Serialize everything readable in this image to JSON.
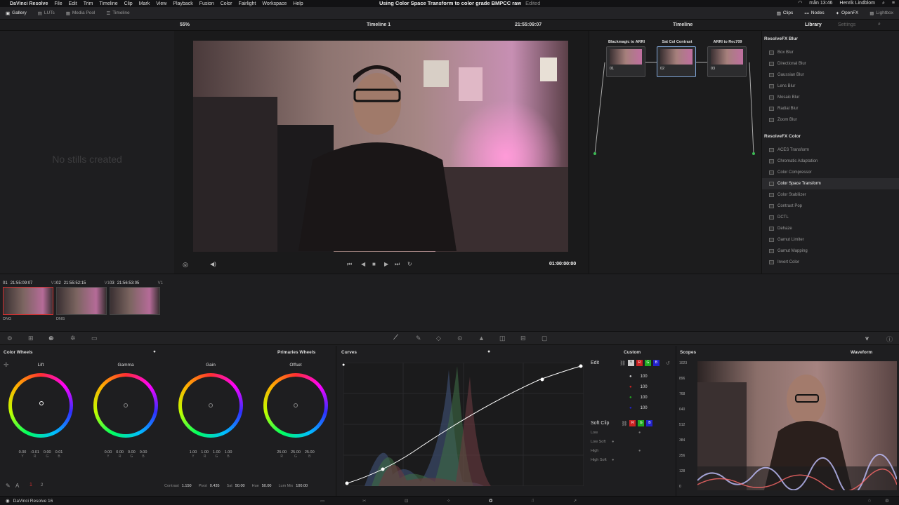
{
  "menubar": {
    "app": "DaVinci Resolve",
    "items": [
      "File",
      "Edit",
      "Trim",
      "Timeline",
      "Clip",
      "Mark",
      "View",
      "Playback",
      "Fusion",
      "Color",
      "Fairlight",
      "Workspace",
      "Help"
    ],
    "title": "Using Color Space Transform to color grade BMPCC raw",
    "edited": "Edited",
    "clock": "mån 13:46",
    "user": "Henrik Lindblom"
  },
  "toolbar": {
    "left": [
      "Gallery",
      "LUTs",
      "Media Pool",
      "Timeline"
    ],
    "right": [
      "Clips",
      "Nodes",
      "OpenFX",
      "Lightbox"
    ]
  },
  "subbar": {
    "zoom": "55%",
    "timeline": "Timeline 1",
    "timecode": "21:55:09:07",
    "nodes_mode": "Timeline",
    "lib_tab": "Library",
    "settings_tab": "Settings"
  },
  "stills": {
    "empty": "No stills created"
  },
  "viewer": {
    "timecode": "01:00:00:00"
  },
  "nodes": [
    {
      "label": "Blackmagic to ARRI",
      "num": "01"
    },
    {
      "label": "Sat Col Contrast",
      "num": "02"
    },
    {
      "label": "ARRI to Rec709",
      "num": "03"
    }
  ],
  "library": {
    "blur_title": "ResolveFX Blur",
    "blur_items": [
      "Box Blur",
      "Directional Blur",
      "Gaussian Blur",
      "Lens Blur",
      "Mosaic Blur",
      "Radial Blur",
      "Zoom Blur"
    ],
    "color_title": "ResolveFX Color",
    "color_items": [
      "ACES Transform",
      "Chromatic Adaptation",
      "Color Compressor",
      "Color Space Transform",
      "Color Stabilizer",
      "Contrast Pop",
      "DCTL",
      "Dehaze",
      "Gamut Limiter",
      "Gamut Mapping",
      "Invert Color"
    ],
    "selected": "Color Space Transform"
  },
  "clips": [
    {
      "num": "01",
      "tc": "21:55:09:07",
      "track": "V1",
      "codec": "DNG"
    },
    {
      "num": "02",
      "tc": "21:55:52:15",
      "track": "V1",
      "codec": "DNG"
    },
    {
      "num": "03",
      "tc": "21:56:53:05",
      "track": "V1",
      "codec": ""
    }
  ],
  "wheels": {
    "title": "Color Wheels",
    "mode": "Primaries Wheels",
    "items": [
      {
        "name": "Lift",
        "vals": [
          "0.00",
          "-0.01",
          "0.00",
          "0.01"
        ],
        "labels": [
          "Y",
          "R",
          "G",
          "B"
        ]
      },
      {
        "name": "Gamma",
        "vals": [
          "0.00",
          "0.00",
          "0.00",
          "0.00"
        ],
        "labels": [
          "Y",
          "R",
          "G",
          "B"
        ]
      },
      {
        "name": "Gain",
        "vals": [
          "1.00",
          "1.00",
          "1.00",
          "1.00"
        ],
        "labels": [
          "Y",
          "R",
          "G",
          "B"
        ]
      },
      {
        "name": "Offset",
        "vals": [
          "25.00",
          "25.00",
          "25.00"
        ],
        "labels": [
          "R",
          "G",
          "B"
        ]
      }
    ],
    "contrast_label": "Contrast",
    "contrast": "1.150",
    "pivot_label": "Pivot",
    "pivot": "0.435",
    "sat_label": "Sat",
    "sat": "50.00",
    "hue_label": "Hue",
    "hue": "50.00",
    "lummix_label": "Lum Mix",
    "lummix": "100.00",
    "page_num": "2"
  },
  "curves": {
    "title": "Curves",
    "mode": "Custom",
    "edit_label": "Edit",
    "edit_vals": [
      "100",
      "100",
      "100",
      "100"
    ],
    "softclip_label": "Soft Clip",
    "low": "Low",
    "lowsoft": "Low Soft",
    "high": "High",
    "highsoft": "High Soft"
  },
  "scopes": {
    "title": "Scopes",
    "mode": "Waveform",
    "ticks": [
      "1023",
      "896",
      "768",
      "640",
      "512",
      "384",
      "256",
      "128",
      "0"
    ]
  },
  "status": {
    "app": "DaVinci Resolve 16"
  }
}
